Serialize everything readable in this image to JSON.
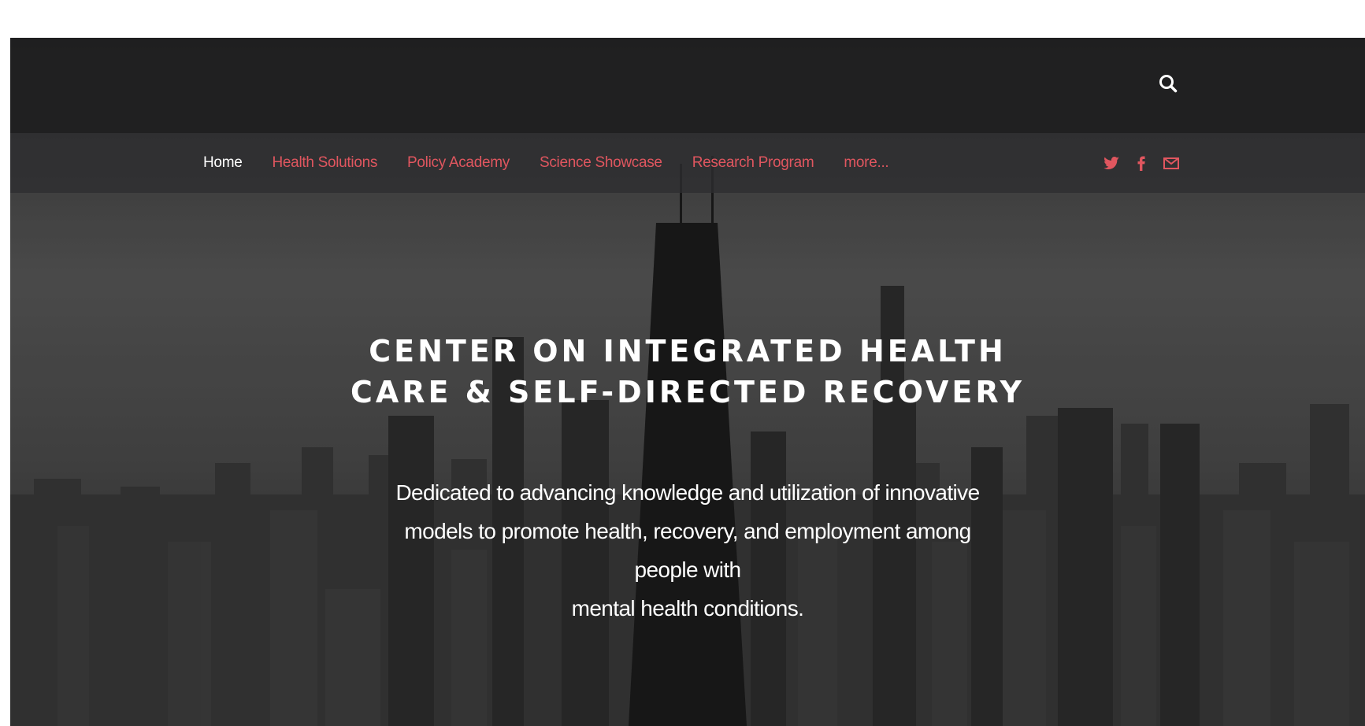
{
  "header": {
    "search_icon": "search-icon"
  },
  "nav": {
    "items": [
      {
        "label": "Home",
        "active": true
      },
      {
        "label": "Health Solutions",
        "active": false
      },
      {
        "label": "Policy Academy",
        "active": false
      },
      {
        "label": "Science Showcase",
        "active": false
      },
      {
        "label": "Research Program",
        "active": false
      },
      {
        "label": "more...",
        "active": false
      }
    ],
    "social": [
      "twitter-icon",
      "facebook-icon",
      "mail-icon"
    ],
    "accent_color": "#e0565f"
  },
  "hero": {
    "title_line1": "CENTER ON INTEGRATED HEALTH",
    "title_line2": "CARE & SELF-DIRECTED RECOVERY",
    "text_line1": "Dedicated to advancing knowledge and utilization of innovative",
    "text_line2": "models to promote health, recovery, and employment among",
    "text_line3": "people with",
    "text_line4": "mental health conditions."
  }
}
